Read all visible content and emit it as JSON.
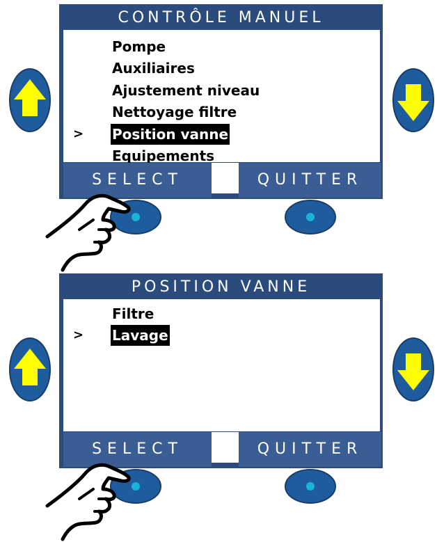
{
  "panels": [
    {
      "title": "CONTRÔLE MANUEL",
      "items": [
        {
          "label": "Pompe",
          "cursor": ""
        },
        {
          "label": "Auxiliaires",
          "cursor": ""
        },
        {
          "label": "Ajustement niveau",
          "cursor": ""
        },
        {
          "label": "Nettoyage filtre",
          "cursor": ""
        },
        {
          "label": "Position vanne",
          "cursor": ">"
        },
        {
          "label": "Equipements",
          "cursor": ""
        }
      ],
      "selected_index": 4,
      "softkeys": {
        "left": "SELECT",
        "right": "QUITTER"
      }
    },
    {
      "title": "POSITION VANNE",
      "items": [
        {
          "label": "Filtre",
          "cursor": ""
        },
        {
          "label": "Lavage",
          "cursor": ">"
        }
      ],
      "selected_index": 1,
      "softkeys": {
        "left": "SELECT",
        "right": "QUITTER"
      }
    }
  ],
  "icons": {
    "up": "arrow-up-icon",
    "down": "arrow-down-icon",
    "pointer": "pointing-hand-icon",
    "round_button": "round-button-icon"
  },
  "colors": {
    "screen_frame": "#2a4b7c",
    "softkey": "#3a5e94",
    "arrow_fill": "#ffff00",
    "button_body": "#1f5c9e",
    "button_dot": "#19b4d8"
  }
}
